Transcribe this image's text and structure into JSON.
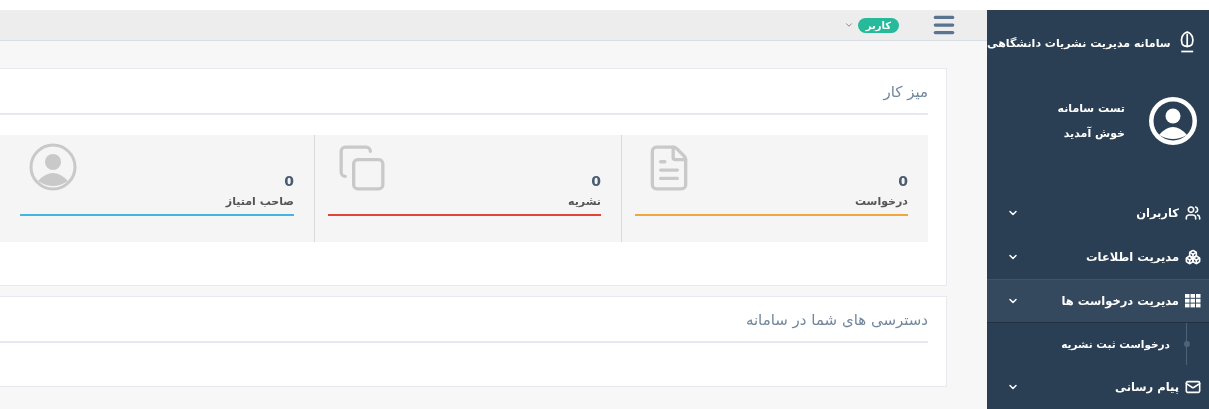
{
  "sidebar": {
    "title": "سامانه مدیریت نشریات دانشگاهی",
    "profile": {
      "name": "تست سامانه",
      "greeting": "خوش آمدید"
    },
    "items": [
      {
        "label": "کاربران",
        "expanded": false
      },
      {
        "label": "مدیریت اطلاعات",
        "expanded": false
      },
      {
        "label": "مدیریت درخواست ها",
        "expanded": true,
        "children": [
          {
            "label": "درخواست ثبت نشریه"
          }
        ]
      },
      {
        "label": "پیام رسانی",
        "expanded": false
      }
    ]
  },
  "header": {
    "role_badge": "کاربر"
  },
  "dashboard": {
    "title": "میز کار",
    "tiles": [
      {
        "count": "0",
        "label": "درخواست",
        "color": "#f0a73e"
      },
      {
        "count": "0",
        "label": "نشریه",
        "color": "#e0443a"
      },
      {
        "count": "0",
        "label": "صاحب امتیاز",
        "color": "#45b6e3"
      }
    ]
  },
  "access": {
    "title": "دسترسی های شما در سامانه"
  }
}
